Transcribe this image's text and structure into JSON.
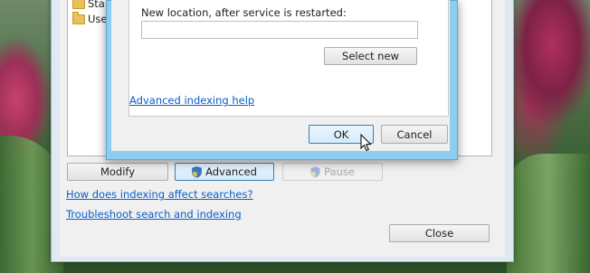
{
  "background_window": {
    "tree_items": [
      "Star",
      "Use"
    ],
    "buttons": {
      "modify": "Modify",
      "advanced": "Advanced",
      "pause": "Pause",
      "close": "Close"
    },
    "links": {
      "how_indexing": "How does indexing affect searches?",
      "troubleshoot": "Troubleshoot search and indexing"
    }
  },
  "advanced_dialog": {
    "new_location_label": "New location, after service is restarted:",
    "new_location_value": "",
    "select_new": "Select new",
    "help_link": "Advanced indexing help",
    "ok": "OK",
    "cancel": "Cancel"
  },
  "colors": {
    "link": "#0a5ec8",
    "dialog_frame": "#8fcdf0",
    "hot_button": "#d4ebfb"
  },
  "icons": [
    "folder-icon",
    "shield-icon",
    "mouse-pointer-icon"
  ]
}
